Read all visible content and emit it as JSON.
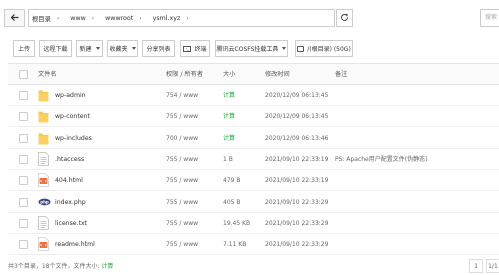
{
  "address_bar": {
    "breadcrumbs": [
      "根目录",
      "www",
      "wwwroot",
      "ysml.xyz"
    ],
    "search_placeholder": "搜索"
  },
  "toolbar": {
    "upload": "上传",
    "remote_download": "远程下载",
    "new": "新建",
    "favorites": "收藏夹",
    "share_list": "分享列表",
    "terminal": "终端",
    "cos_mount": "腾讯云COSFS挂载工具",
    "disk": "/(根目录) (50G)"
  },
  "table": {
    "headers": {
      "name": "文件名",
      "perm": "权限 / 所有者",
      "size": "大小",
      "mtime": "修改时间",
      "note": "备注"
    },
    "rows": [
      {
        "name": "wp-admin",
        "type": "folder",
        "perm": "754 / www",
        "size": "计算",
        "mtime": "2020/12/09 06:13:45",
        "note": ""
      },
      {
        "name": "wp-content",
        "type": "folder",
        "perm": "755 / www",
        "size": "计算",
        "mtime": "2020/12/09 06:13:45",
        "note": ""
      },
      {
        "name": "wp-includes",
        "type": "folder",
        "perm": "700 / www",
        "size": "计算",
        "mtime": "2020/12/09 06:13:46",
        "note": ""
      },
      {
        "name": ".htaccess",
        "type": "text",
        "perm": "755 / www",
        "size": "1 B",
        "mtime": "2021/09/10 22:33:19",
        "note": "PS: Apache用户配置文件(伪静态)"
      },
      {
        "name": "404.html",
        "type": "html",
        "perm": "755 / www",
        "size": "479 B",
        "mtime": "2021/09/10 22:33:19",
        "note": ""
      },
      {
        "name": "index.php",
        "type": "php",
        "perm": "755 / www",
        "size": "405 B",
        "mtime": "2021/09/10 22:33:29",
        "note": ""
      },
      {
        "name": "license.txt",
        "type": "text",
        "perm": "755 / www",
        "size": "19.45 KB",
        "mtime": "2021/09/10 22:33:29",
        "note": ""
      },
      {
        "name": "readme.html",
        "type": "html",
        "perm": "755 / www",
        "size": "7.11 KB",
        "mtime": "2021/09/10 22:33:29",
        "note": ""
      }
    ]
  },
  "footer": {
    "summary": "共3个目录，18个文件，文件大小:",
    "calc": "计算",
    "page_current": "1",
    "page_total": "1/1"
  },
  "colors": {
    "accent_green": "#20a53a",
    "folder_yellow": "#f5c443",
    "html_orange": "#e8743b",
    "php_navy": "#3b4a7a"
  }
}
